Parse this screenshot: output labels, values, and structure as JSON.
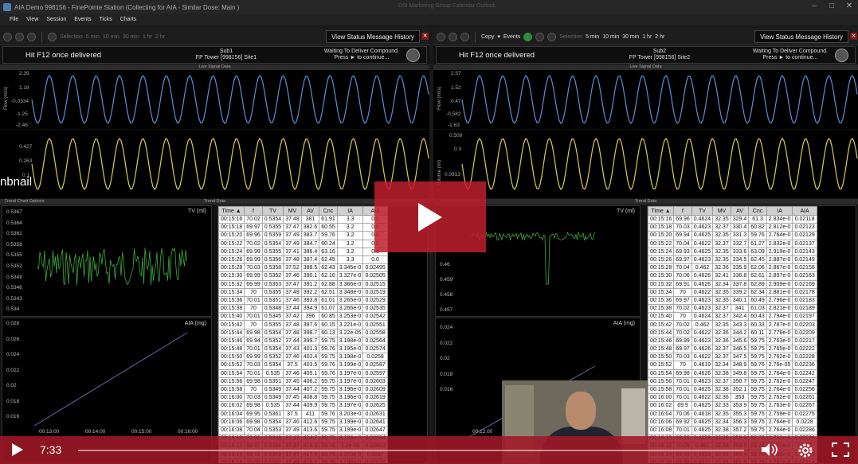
{
  "window": {
    "title": "AIA Demo 998156 - FinePointe Station (Collecting for AIA - Similar Dose: Main )",
    "center_text": "DSI Marketing Group   Calendar   Outlook"
  },
  "menu": [
    "File",
    "View",
    "Session",
    "Events",
    "Ticks",
    "Charts"
  ],
  "left_toolbar": {
    "selection_label": "Selection",
    "intervals": [
      "5 min",
      "10 min",
      "30 min",
      "1 hr",
      "2 hr"
    ]
  },
  "right_toolbar": {
    "copy_label": "Copy",
    "events_label": "Events",
    "selection_label": "Selection",
    "intervals": [
      "5 min",
      "10 min",
      "30 min",
      "1 hr",
      "2 hr"
    ]
  },
  "status_history_label": "View Status Message History",
  "left_status": {
    "message": "Hit F12 once delivered",
    "sub": "Sub1",
    "tower": "FP Tower [998156] Site1",
    "waiting": "Waiting To Deliver Compound.",
    "press": "Press ► to continue..."
  },
  "right_status": {
    "message": "Hit F12 once delivered",
    "sub": "Sub2",
    "tower": "FP Tower [998156] Site2",
    "waiting": "Waiting To Deliver Compound.",
    "press": "Press ► to continue..."
  },
  "live_signal_header": "Live Signal Data",
  "trend_header": "Trend Data",
  "trend_options": "Trend Chart Options",
  "left_live": {
    "flow_label": "Flow (ml/s)",
    "flow_ticks": [
      "2.39",
      "1.18",
      "-0.0334",
      "-1.25",
      "-2.46"
    ],
    "volume_ticks": [
      "0.427",
      "0.263",
      "0.1"
    ]
  },
  "right_live": {
    "flow_label": "Flow (ml/s)",
    "volume_label": "Volume (ml)",
    "flow_ticks": [
      "2.57",
      "1.52",
      "0.47",
      "-0.582",
      "-1.63"
    ],
    "volume_ticks": [
      "0.509",
      "0.3",
      "0.0913"
    ]
  },
  "left_tv_chart": {
    "label": "TV (ml)",
    "ticks": [
      "0.5367",
      "0.5364",
      "0.5361",
      "0.5358",
      "0.5355",
      "0.5352",
      "0.5349",
      "0.5346",
      "0.5343",
      "0.534"
    ]
  },
  "left_aia_chart": {
    "label": "AIA (mg)",
    "ticks": [
      "0.028",
      "0.026",
      "0.024",
      "0.022",
      "0.02",
      "0.018",
      "0.016"
    ],
    "xticks": [
      "00:13:00",
      "00:14:00",
      "00:15:00",
      "00:16:00"
    ]
  },
  "right_tv_chart": {
    "label": "TV (ml)",
    "ticks": [
      "0.46",
      "0.459",
      "0.458",
      "0.457"
    ]
  },
  "right_aia_chart": {
    "label": "AIA (mg)",
    "ticks": [
      "0.024",
      "0.022",
      "0.02",
      "0.018",
      "0.016"
    ],
    "xticks": [
      "00:12:00",
      "00:13:00"
    ]
  },
  "left_table": {
    "headers": [
      "Time ▲",
      "f",
      "TV",
      "MV",
      "AV",
      "Cnc",
      "IA",
      "AIA"
    ],
    "rows": [
      [
        "00:15:16",
        "70.02",
        "0.5354",
        "37.48",
        "381",
        "61.91",
        "3.3",
        "0.0"
      ],
      [
        "00:15:18",
        "69.97",
        "0.5355",
        "37.47",
        "382.6",
        "60.55",
        "3.2",
        "0.0"
      ],
      [
        "00:15:20",
        "69.96",
        "0.5359",
        "37.49",
        "383.7",
        "59.76",
        "3.2",
        "0.0"
      ],
      [
        "00:15:22",
        "70.02",
        "0.5354",
        "37.49",
        "384.7",
        "60.24",
        "3.2",
        "0.0"
      ],
      [
        "00:15:24",
        "69.99",
        "0.5355",
        "37.41",
        "386.4",
        "63.16",
        "3.2",
        "0.0"
      ],
      [
        "00:15:26",
        "69.99",
        "0.5356",
        "37.48",
        "387.4",
        "62.45",
        "3.3",
        "0.0"
      ],
      [
        "00:15:28",
        "70.03",
        "0.5358",
        "37.52",
        "388.5",
        "62.43",
        "3.345e-0",
        "0.02495"
      ],
      [
        "00:15:30",
        "69.99",
        "0.5352",
        "37.46",
        "390.1",
        "62.16",
        "3.327e-0",
        "0.02505"
      ],
      [
        "00:15:32",
        "69.99",
        "0.5353",
        "37.47",
        "391.2",
        "62.88",
        "3.366e-0",
        "0.02515"
      ],
      [
        "00:15:34",
        "70",
        "0.5355",
        "37.49",
        "392.2",
        "62.51",
        "3.348e-0",
        "0.02519"
      ],
      [
        "00:15:36",
        "70.01",
        "0.5351",
        "37.46",
        "393.8",
        "61.01",
        "3.265e-0",
        "0.02529"
      ],
      [
        "00:15:38",
        "70",
        "0.5348",
        "37.44",
        "394.9",
        "61.07",
        "3.266e-0",
        "0.02535"
      ],
      [
        "00:15:40",
        "70.01",
        "0.5345",
        "37.42",
        "396",
        "60.85",
        "3.253e-0",
        "0.02542"
      ],
      [
        "00:15:42",
        "70",
        "0.5355",
        "37.48",
        "397.6",
        "60.15",
        "3.221e-0",
        "0.02551"
      ],
      [
        "00:15:44",
        "69.98",
        "0.5354",
        "37.48",
        "398.7",
        "60.13",
        "3.22e-05",
        "0.02558"
      ],
      [
        "00:15:46",
        "69.94",
        "0.5352",
        "37.44",
        "399.7",
        "59.75",
        "3.198e-0",
        "0.02564"
      ],
      [
        "00:15:48",
        "70.01",
        "0.5354",
        "37.43",
        "401.3",
        "59.76",
        "3.195e-0",
        "0.02574"
      ],
      [
        "00:15:50",
        "69.99",
        "0.5352",
        "37.46",
        "402.4",
        "59.75",
        "3.198e-0",
        "0.0258"
      ],
      [
        "00:15:52",
        "70.03",
        "0.5354",
        "37.5",
        "403.5",
        "59.76",
        "3.199e-0",
        "0.02587"
      ],
      [
        "00:15:54",
        "70.01",
        "0.535",
        "37.46",
        "405.1",
        "59.76",
        "3.197e-0",
        "0.02597"
      ],
      [
        "00:15:56",
        "69.98",
        "0.5351",
        "37.45",
        "406.2",
        "59.75",
        "3.197e-0",
        "0.02603"
      ],
      [
        "00:15:58",
        "70",
        "0.5349",
        "37.44",
        "407.2",
        "59.75",
        "3.196e-0",
        "0.02609"
      ],
      [
        "00:16:00",
        "70.03",
        "0.5349",
        "37.45",
        "408.8",
        "59.75",
        "3.196e-0",
        "0.02619"
      ],
      [
        "00:16:02",
        "69.98",
        "0.535",
        "37.44",
        "409.9",
        "59.75",
        "3.197e-0",
        "0.02625"
      ],
      [
        "00:16:04",
        "69.95",
        "0.5361",
        "37.5",
        "411",
        "59.76",
        "3.203e-0",
        "0.02631"
      ],
      [
        "00:16:06",
        "69.98",
        "0.5354",
        "37.46",
        "412.6",
        "59.75",
        "3.199e-0",
        "0.02641"
      ],
      [
        "00:16:08",
        "70.04",
        "0.5353",
        "37.49",
        "413.6",
        "59.75",
        "3.199e-0",
        "0.02647"
      ],
      [
        "00:16:10",
        "70.06",
        "0.5348",
        "37.47",
        "414.7",
        "59.75",
        "3.196e-0",
        "0.02654"
      ],
      [
        "00:16:12",
        "69.97",
        "0.5356",
        "37.47",
        "416.3",
        "59.76",
        "3.2e-05",
        "0.02663"
      ],
      [
        "00:16:14",
        "69.91",
        "0.5359",
        "37.47",
        "417.4",
        "59.75",
        "3.203e-0",
        "0.0267"
      ],
      [
        "00:16:16",
        "70.05",
        "0.5352",
        "37.49",
        "418.5",
        "59.76",
        "3.198e-0",
        "0.02676"
      ]
    ]
  },
  "right_table": {
    "headers": [
      "Time ▲",
      "f",
      "TV",
      "MV",
      "AV",
      "Cnc",
      "IA",
      "AIA"
    ],
    "rows": [
      [
        "00:15:16",
        "69.96",
        "0.4624",
        "32.35",
        "329.4",
        "61.3",
        "2.834e-0",
        "0.02118"
      ],
      [
        "00:15:18",
        "70.03",
        "0.4623",
        "32.37",
        "330.4",
        "60.82",
        "2.812e-0",
        "0.02123"
      ],
      [
        "00:15:20",
        "69.94",
        "0.4625",
        "32.35",
        "331.3",
        "59.76",
        "2.764e-0",
        "0.02129"
      ],
      [
        "00:15:22",
        "70.04",
        "0.4622",
        "32.37",
        "332.7",
        "61.27",
        "2.832e-0",
        "0.02137"
      ],
      [
        "00:15:24",
        "69.93",
        "0.4625",
        "32.35",
        "333.6",
        "63.09",
        "2.919e-0",
        "0.02143"
      ],
      [
        "00:15:26",
        "69.97",
        "0.4623",
        "32.35",
        "334.5",
        "62.45",
        "2.887e-0",
        "0.02149"
      ],
      [
        "00:15:28",
        "70.04",
        "0.462",
        "32.36",
        "335.9",
        "62.06",
        "2.867e-0",
        "0.02158"
      ],
      [
        "00:15:30",
        "70.06",
        "0.4626",
        "32.41",
        "336.8",
        "62.61",
        "2.897e-0",
        "0.02163"
      ],
      [
        "00:15:32",
        "69.91",
        "0.4626",
        "32.34",
        "337.8",
        "62.89",
        "2.909e-0",
        "0.02169"
      ],
      [
        "00:15:34",
        "70",
        "0.4622",
        "32.35",
        "339.2",
        "62.34",
        "2.881e-0",
        "0.02178"
      ],
      [
        "00:15:36",
        "69.97",
        "0.4623",
        "32.35",
        "340.1",
        "60.49",
        "2.796e-0",
        "0.02183"
      ],
      [
        "00:15:38",
        "70.02",
        "0.4623",
        "32.37",
        "341",
        "61.03",
        "2.821e-0",
        "0.02189"
      ],
      [
        "00:15:40",
        "70",
        "0.4624",
        "32.37",
        "342.4",
        "60.43",
        "2.794e-0",
        "0.02197"
      ],
      [
        "00:15:42",
        "70.02",
        "0.462",
        "32.35",
        "343.3",
        "60.33",
        "2.787e-0",
        "0.02203"
      ],
      [
        "00:15:44",
        "70.02",
        "0.4622",
        "32.36",
        "344.2",
        "60.11",
        "2.778e-0",
        "0.02209"
      ],
      [
        "00:15:46",
        "69.99",
        "0.4623",
        "32.36",
        "345.6",
        "59.75",
        "2.763e-0",
        "0.02217"
      ],
      [
        "00:15:48",
        "69.97",
        "0.4626",
        "32.37",
        "346.5",
        "59.75",
        "2.765e-0",
        "0.02222"
      ],
      [
        "00:15:50",
        "70.03",
        "0.4622",
        "32.37",
        "347.5",
        "59.75",
        "2.762e-0",
        "0.02228"
      ],
      [
        "00:15:52",
        "70",
        "0.4619",
        "32.34",
        "348.9",
        "59.76",
        "2.76e-05",
        "0.02236"
      ],
      [
        "00:15:54",
        "69.98",
        "0.4626",
        "32.38",
        "349.8",
        "59.75",
        "2.764e-0",
        "0.02242"
      ],
      [
        "00:15:56",
        "70.01",
        "0.4623",
        "32.37",
        "350.7",
        "59.75",
        "2.762e-0",
        "0.02247"
      ],
      [
        "00:15:58",
        "70.01",
        "0.4625",
        "32.38",
        "352.1",
        "59.75",
        "2.764e-0",
        "0.02256"
      ],
      [
        "00:16:00",
        "70.01",
        "0.4622",
        "32.36",
        "353",
        "59.75",
        "2.762e-0",
        "0.02261"
      ],
      [
        "00:16:02",
        "69.9",
        "0.4625",
        "32.33",
        "353.9",
        "59.75",
        "2.763e-0",
        "0.02267"
      ],
      [
        "00:16:04",
        "70.06",
        "0.4618",
        "32.35",
        "355.3",
        "59.75",
        "2.759e-0",
        "0.02275"
      ],
      [
        "00:16:06",
        "69.92",
        "0.4625",
        "32.34",
        "356.3",
        "59.75",
        "2.764e-0",
        "0.0228"
      ],
      [
        "00:16:08",
        "70.01",
        "0.4625",
        "32.38",
        "357.2",
        "59.75",
        "2.764e-0",
        "0.02286"
      ],
      [
        "00:16:10",
        "69.99",
        "0.4623",
        "32.36",
        "358.6",
        "59.76",
        "2.762e-0",
        "0.02294"
      ],
      [
        "00:16:12",
        "70.09",
        "0.462",
        "32.38",
        "359.5",
        "59.76",
        "2.761e-0",
        "0.023"
      ],
      [
        "00:16:14",
        "69.93",
        "0.4623",
        "32.35",
        "360.4",
        "59.76",
        "2.762e-0",
        "0.02305"
      ],
      [
        "00:16:16",
        "69.96",
        "0.4622",
        "32.32",
        "361.9",
        "59.75",
        "2.762e-0",
        "0.02314"
      ]
    ]
  },
  "overlay": {
    "thumbnail_text": "nbnail",
    "time": "7:33",
    "progress_fraction": 0.0
  },
  "colors": {
    "accent": "#be1e2d",
    "flow_wave": "#5b8fd6",
    "volume_wave": "#d8d04a",
    "trend_tv": "#3ea83e",
    "trend_aia": "#6b6bb0"
  }
}
